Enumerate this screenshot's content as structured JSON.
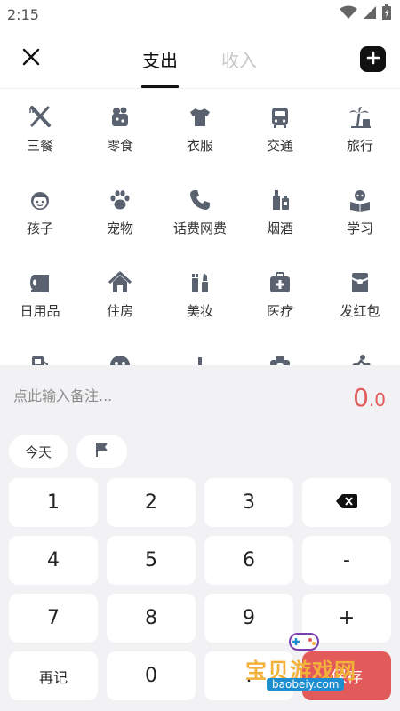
{
  "status_bar": {
    "time": "2:15"
  },
  "header": {
    "tabs": [
      {
        "label": "支出"
      },
      {
        "label": "收入"
      }
    ]
  },
  "categories": [
    {
      "label": "三餐",
      "icon": "utensils-icon"
    },
    {
      "label": "零食",
      "icon": "snack-icon"
    },
    {
      "label": "衣服",
      "icon": "shirt-icon"
    },
    {
      "label": "交通",
      "icon": "bus-icon"
    },
    {
      "label": "旅行",
      "icon": "palm-tree-icon"
    },
    {
      "label": "孩子",
      "icon": "child-icon"
    },
    {
      "label": "宠物",
      "icon": "paw-icon"
    },
    {
      "label": "话费网费",
      "icon": "phone-icon"
    },
    {
      "label": "烟酒",
      "icon": "bottle-icon"
    },
    {
      "label": "学习",
      "icon": "reading-icon"
    },
    {
      "label": "日用品",
      "icon": "tissue-roll-icon"
    },
    {
      "label": "住房",
      "icon": "house-icon"
    },
    {
      "label": "美妆",
      "icon": "cosmetics-icon"
    },
    {
      "label": "医疗",
      "icon": "medical-kit-icon"
    },
    {
      "label": "发红包",
      "icon": "red-envelope-icon"
    },
    {
      "label": "",
      "icon": "gas-station-icon"
    },
    {
      "label": "",
      "icon": "gamepad-icon"
    },
    {
      "label": "",
      "icon": "tray-icon"
    },
    {
      "label": "",
      "icon": "camera-icon"
    },
    {
      "label": "",
      "icon": "running-icon"
    }
  ],
  "note": {
    "placeholder": "点此输入备注..."
  },
  "amount": {
    "integer": "0",
    "decimal": ".0"
  },
  "chips": {
    "today": "今天"
  },
  "keypad": {
    "k1": "1",
    "k2": "2",
    "k3": "3",
    "k4": "4",
    "k5": "5",
    "k6": "6",
    "minus": "-",
    "k7": "7",
    "k8": "8",
    "k9": "9",
    "plus": "+",
    "again": "再记",
    "k0": "0",
    "dot": ".",
    "save": "保存"
  },
  "watermark": {
    "text": "宝贝游戏网",
    "url": "baobeiy.com"
  },
  "colors": {
    "accent": "#e35a5a",
    "icon": "#5a6270",
    "keypad_bg": "#f2f2f4"
  }
}
